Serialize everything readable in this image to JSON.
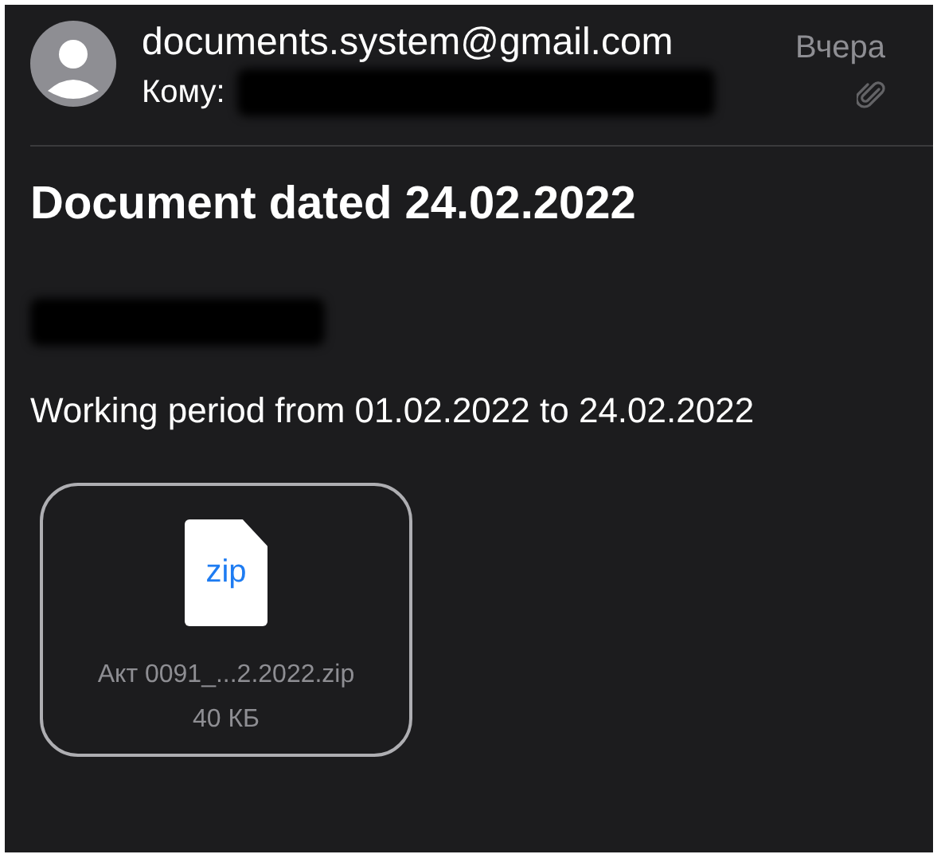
{
  "header": {
    "sender": "documents.system@gmail.com",
    "recipient_label": "Кому:",
    "date": "Вчера",
    "has_attachment": true
  },
  "message": {
    "subject": "Document dated 24.02.2022",
    "body": "Working period from 01.02.2022 to 24.02.2022"
  },
  "attachments": [
    {
      "badge": "zip",
      "name": "Акт 0091_...2.2022.zip",
      "size": "40 КБ"
    }
  ]
}
